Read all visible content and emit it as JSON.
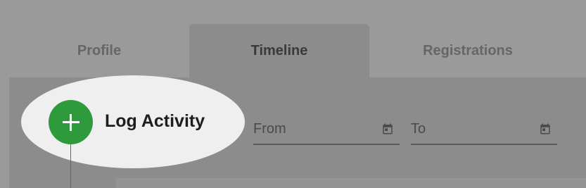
{
  "tabs": [
    {
      "label": "Profile",
      "active": false
    },
    {
      "label": "Timeline",
      "active": true
    },
    {
      "label": "Registrations",
      "active": false
    }
  ],
  "log_activity": {
    "label": "Log Activity",
    "icon": "plus-icon",
    "color": "#2f9a3c"
  },
  "filters": {
    "from": {
      "placeholder": "From",
      "icon": "calendar-icon"
    },
    "to": {
      "placeholder": "To",
      "icon": "calendar-icon"
    }
  }
}
